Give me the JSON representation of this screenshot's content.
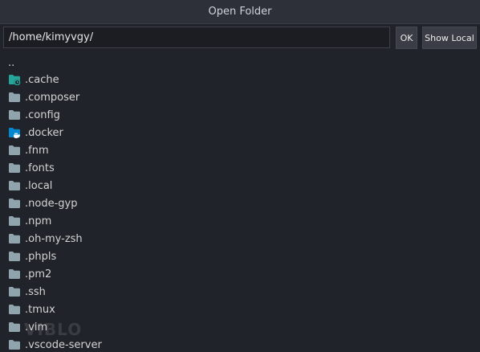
{
  "dialog": {
    "title": "Open Folder"
  },
  "toolbar": {
    "path_value": "/home/kimyvgy/",
    "ok_label": "OK",
    "show_local_label": "Show Local"
  },
  "list": {
    "parent_label": "..",
    "items": [
      {
        "name": ".cache",
        "icon": "folder-cache-icon"
      },
      {
        "name": ".composer",
        "icon": "folder-icon"
      },
      {
        "name": ".config",
        "icon": "folder-icon"
      },
      {
        "name": ".docker",
        "icon": "folder-docker-icon"
      },
      {
        "name": ".fnm",
        "icon": "folder-icon"
      },
      {
        "name": ".fonts",
        "icon": "folder-icon"
      },
      {
        "name": ".local",
        "icon": "folder-icon"
      },
      {
        "name": ".node-gyp",
        "icon": "folder-icon"
      },
      {
        "name": ".npm",
        "icon": "folder-icon"
      },
      {
        "name": ".oh-my-zsh",
        "icon": "folder-icon"
      },
      {
        "name": ".phpls",
        "icon": "folder-icon"
      },
      {
        "name": ".pm2",
        "icon": "folder-icon"
      },
      {
        "name": ".ssh",
        "icon": "folder-icon"
      },
      {
        "name": ".tmux",
        "icon": "folder-icon"
      },
      {
        "name": ".vim",
        "icon": "folder-icon"
      },
      {
        "name": ".vscode-server",
        "icon": "folder-icon"
      }
    ]
  },
  "watermark": "VIBLO",
  "colors": {
    "folder": "#90a4ae",
    "cache_folder": "#26a69a",
    "docker_folder": "#0288d1"
  }
}
